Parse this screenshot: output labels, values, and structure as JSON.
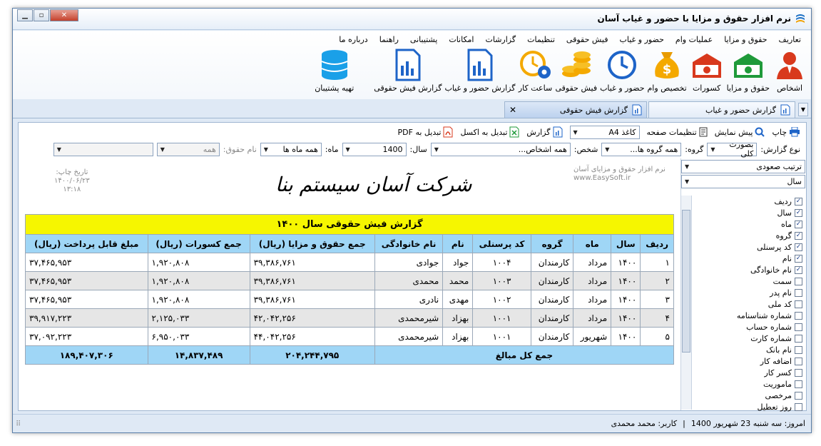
{
  "window": {
    "title": "نرم افزار حقوق و مزایا با حضور و غیاب آسان"
  },
  "menu": [
    "تعاریف",
    "حقوق و مزایا",
    "عملیات وام",
    "حضور و غیاب",
    "فیش حقوقی",
    "تنظیمات",
    "گزارشات",
    "امکانات",
    "پشتیبانی",
    "راهنما",
    "درباره ما"
  ],
  "ribbon": [
    {
      "label": "اشخاص",
      "icon": "person-icon"
    },
    {
      "label": "حقوق و مزایا",
      "icon": "money-icon"
    },
    {
      "label": "کسورات",
      "icon": "money-red-icon"
    },
    {
      "label": "تخصیص وام",
      "icon": "money-bag-icon"
    },
    {
      "label": "حضور و غیاب",
      "icon": "clock-icon"
    },
    {
      "label": "فیش حقوقی",
      "icon": "coins-icon"
    },
    {
      "label": "ساعت کار",
      "icon": "clock-gear-icon"
    },
    {
      "label": "گزارش حضور و غیاب",
      "icon": "report-icon"
    },
    {
      "label": "گزارش فیش حقوقی",
      "icon": "report-icon"
    },
    {
      "label": "تهیه پشتیبان",
      "icon": "database-icon"
    }
  ],
  "tabs": [
    {
      "label": "گزارش حضور و غیاب",
      "active": false
    },
    {
      "label": "گزارش فیش حقوقی",
      "active": true
    }
  ],
  "toolbar": {
    "print": "چاپ",
    "preview": "پیش نمایش",
    "page_settings": "تنظیمات صفحه",
    "paper": "کاغذ A4",
    "report": "گزارش",
    "excel": "تبدیل به اکسل",
    "pdf": "تبدیل به PDF"
  },
  "filters": {
    "report_type_label": "نوع گزارش:",
    "report_type": "بصورت کلی",
    "group_label": "گروه:",
    "group": "همه گروه ها...",
    "person_label": "شخص:",
    "person": "همه اشخاص...",
    "year_label": "سال:",
    "year": "1400",
    "month_label": "ماه:",
    "month": "همه ماه ها",
    "salary_label": "نام حقوق:",
    "salary": "همه"
  },
  "sidebar": {
    "sort": "ترتیب صعودی",
    "sort_field": "سال",
    "columns": [
      {
        "label": "ردیف",
        "checked": true
      },
      {
        "label": "سال",
        "checked": true
      },
      {
        "label": "ماه",
        "checked": true
      },
      {
        "label": "گروه",
        "checked": true
      },
      {
        "label": "کد پرسنلی",
        "checked": true
      },
      {
        "label": "نام",
        "checked": true
      },
      {
        "label": "نام خانوادگی",
        "checked": true
      },
      {
        "label": "سمت",
        "checked": false
      },
      {
        "label": "نام پدر",
        "checked": false
      },
      {
        "label": "کد ملی",
        "checked": false
      },
      {
        "label": "شماره شناسنامه",
        "checked": false
      },
      {
        "label": "شماره حساب",
        "checked": false
      },
      {
        "label": "شماره کارت",
        "checked": false
      },
      {
        "label": "نام بانک",
        "checked": false
      },
      {
        "label": "اضافه کار",
        "checked": false
      },
      {
        "label": "کسر کار",
        "checked": false
      },
      {
        "label": "ماموریت",
        "checked": false
      },
      {
        "label": "مرخصی",
        "checked": false
      },
      {
        "label": "روز تعطیل",
        "checked": false
      }
    ]
  },
  "report": {
    "print_date_label": "تاریخ چاپ:",
    "print_date": "۱۴۰۰/۰۶/۲۳",
    "print_time": "۱۳:۱۸",
    "software_name": "نرم افزار حقوق و مزایای آسان",
    "website": "www.EasySoft.ir",
    "company": "شرکت آسان سیستم بنا",
    "title": "گزارش فیش حقوقی سال ۱۴۰۰",
    "headers": [
      "ردیف",
      "سال",
      "ماه",
      "گروه",
      "کد پرسنلی",
      "نام",
      "نام خانوادگی",
      "جمع حقوق و مزایا (ریال)",
      "جمع کسورات (ریال)",
      "مبلغ قابل پرداخت (ریال)"
    ],
    "rows": [
      [
        "۱",
        "۱۴۰۰",
        "مرداد",
        "کارمندان",
        "۱۰۰۴",
        "جواد",
        "جوادی",
        "۳۹,۳۸۶,۷۶۱",
        "۱,۹۲۰,۸۰۸",
        "۳۷,۴۶۵,۹۵۳"
      ],
      [
        "۲",
        "۱۴۰۰",
        "مرداد",
        "کارمندان",
        "۱۰۰۳",
        "محمد",
        "محمدی",
        "۳۹,۳۸۶,۷۶۱",
        "۱,۹۲۰,۸۰۸",
        "۳۷,۴۶۵,۹۵۳"
      ],
      [
        "۳",
        "۱۴۰۰",
        "مرداد",
        "کارمندان",
        "۱۰۰۲",
        "مهدی",
        "نادری",
        "۳۹,۳۸۶,۷۶۱",
        "۱,۹۲۰,۸۰۸",
        "۳۷,۴۶۵,۹۵۳"
      ],
      [
        "۴",
        "۱۴۰۰",
        "مرداد",
        "کارمندان",
        "۱۰۰۱",
        "بهزاد",
        "شیرمحمدی",
        "۴۲,۰۴۲,۲۵۶",
        "۲,۱۲۵,۰۳۳",
        "۳۹,۹۱۷,۲۲۳"
      ],
      [
        "۵",
        "۱۴۰۰",
        "شهریور",
        "کارمندان",
        "۱۰۰۱",
        "بهزاد",
        "شیرمحمدی",
        "۴۴,۰۴۲,۲۵۶",
        "۶,۹۵۰,۰۳۳",
        "۳۷,۰۹۲,۲۲۳"
      ]
    ],
    "total_label": "جمع کل مبالغ",
    "totals": [
      "۲۰۴,۲۴۴,۷۹۵",
      "۱۴,۸۳۷,۴۸۹",
      "۱۸۹,۴۰۷,۳۰۶"
    ]
  },
  "status": {
    "today": "امروز: سه شنبه 23 شهریور 1400",
    "user": "کاربر: محمد محمدی"
  },
  "colors": {
    "title_row": "#f6f600",
    "header_row": "#9fd6f6",
    "even_row": "#e6e6e6"
  }
}
